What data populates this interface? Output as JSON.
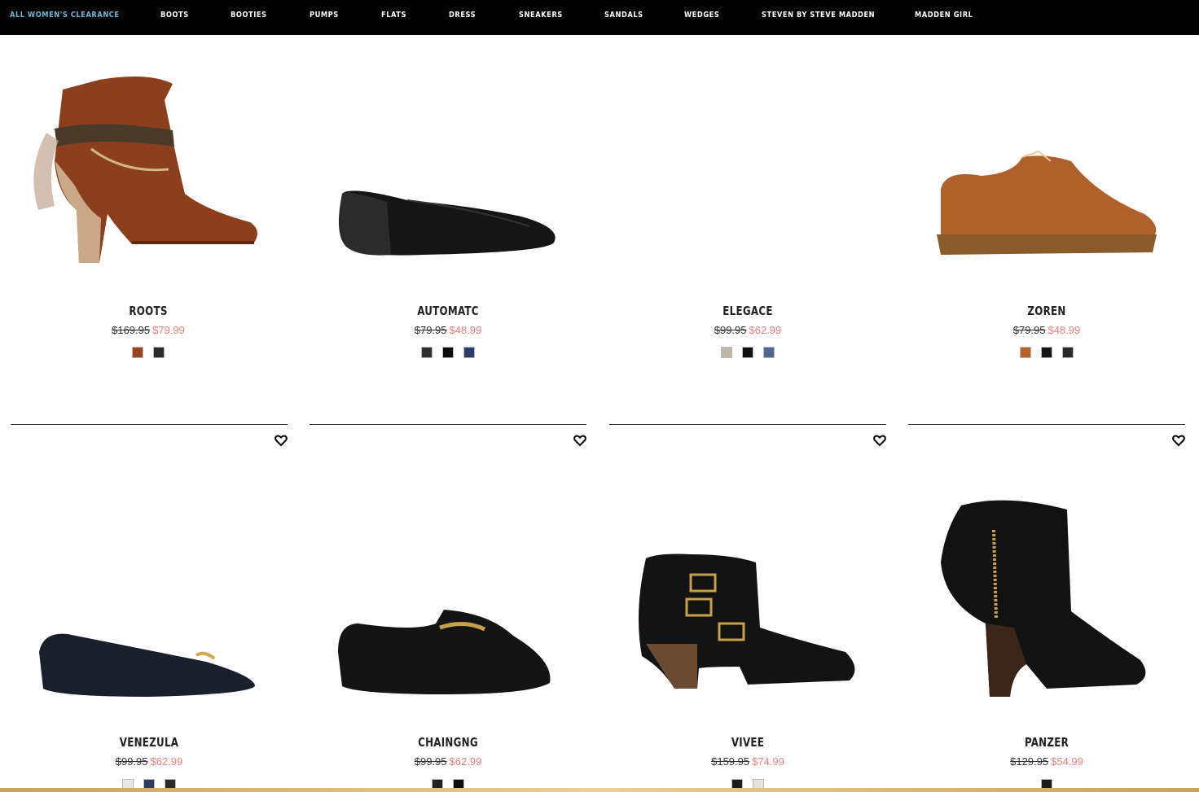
{
  "nav": [
    {
      "label": "ALL WOMEN'S CLEARANCE",
      "active": true
    },
    {
      "label": "BOOTS"
    },
    {
      "label": "BOOTIES"
    },
    {
      "label": "PUMPS"
    },
    {
      "label": "FLATS"
    },
    {
      "label": "DRESS"
    },
    {
      "label": "SNEAKERS"
    },
    {
      "label": "SANDALS"
    },
    {
      "label": "WEDGES"
    },
    {
      "label": "STEVEN BY STEVE MADDEN"
    },
    {
      "label": "MADDEN GIRL"
    }
  ],
  "products": [
    {
      "name": "ROOTS",
      "old_price": "$169.95",
      "sale_price": "$79.99",
      "image": "brown-western-bootie-image",
      "swatches": [
        "#9a4422",
        "#2b2b2b"
      ],
      "divider": false
    },
    {
      "name": "AUTOMATC",
      "old_price": "$79.95",
      "sale_price": "$48.99",
      "image": "black-pointed-flat-image",
      "swatches": [
        "#2e2e2e",
        "#0d0d0d",
        "#2a3d66"
      ],
      "divider": false
    },
    {
      "name": "ELEGACE",
      "old_price": "$99.95",
      "sale_price": "$62.99",
      "image": "",
      "swatches": [
        "#bfb6a6",
        "#111111",
        "#53678e"
      ],
      "divider": false
    },
    {
      "name": "ZOREN",
      "old_price": "$79.95",
      "sale_price": "$48.99",
      "image": "tan-oxford-image",
      "swatches": [
        "#b8622b",
        "#151515",
        "#2a2a2a"
      ],
      "divider": false
    },
    {
      "name": "VENEZULA",
      "old_price": "$99.95",
      "sale_price": "$62.99",
      "image": "navy-chain-flat-image",
      "swatches": [
        "#e8e8e8",
        "#2c3b5e",
        "#2a2a2a"
      ],
      "divider": true
    },
    {
      "name": "CHAINGNG",
      "old_price": "$99.95",
      "sale_price": "$62.99",
      "image": "black-chain-loafer-image",
      "swatches": [
        "#222222",
        "#0e0e0e"
      ],
      "divider": true
    },
    {
      "name": "VIVEE",
      "old_price": "$159.95",
      "sale_price": "$74.99",
      "image": "black-buckle-bootie-image",
      "swatches": [
        "#1c1c1c",
        "#e6e2d8"
      ],
      "divider": true
    },
    {
      "name": "PANZER",
      "old_price": "$129.95",
      "sale_price": "$54.99",
      "image": "black-suede-cuff-boot-image",
      "swatches": [
        "#1a1a1a"
      ],
      "divider": true
    }
  ]
}
